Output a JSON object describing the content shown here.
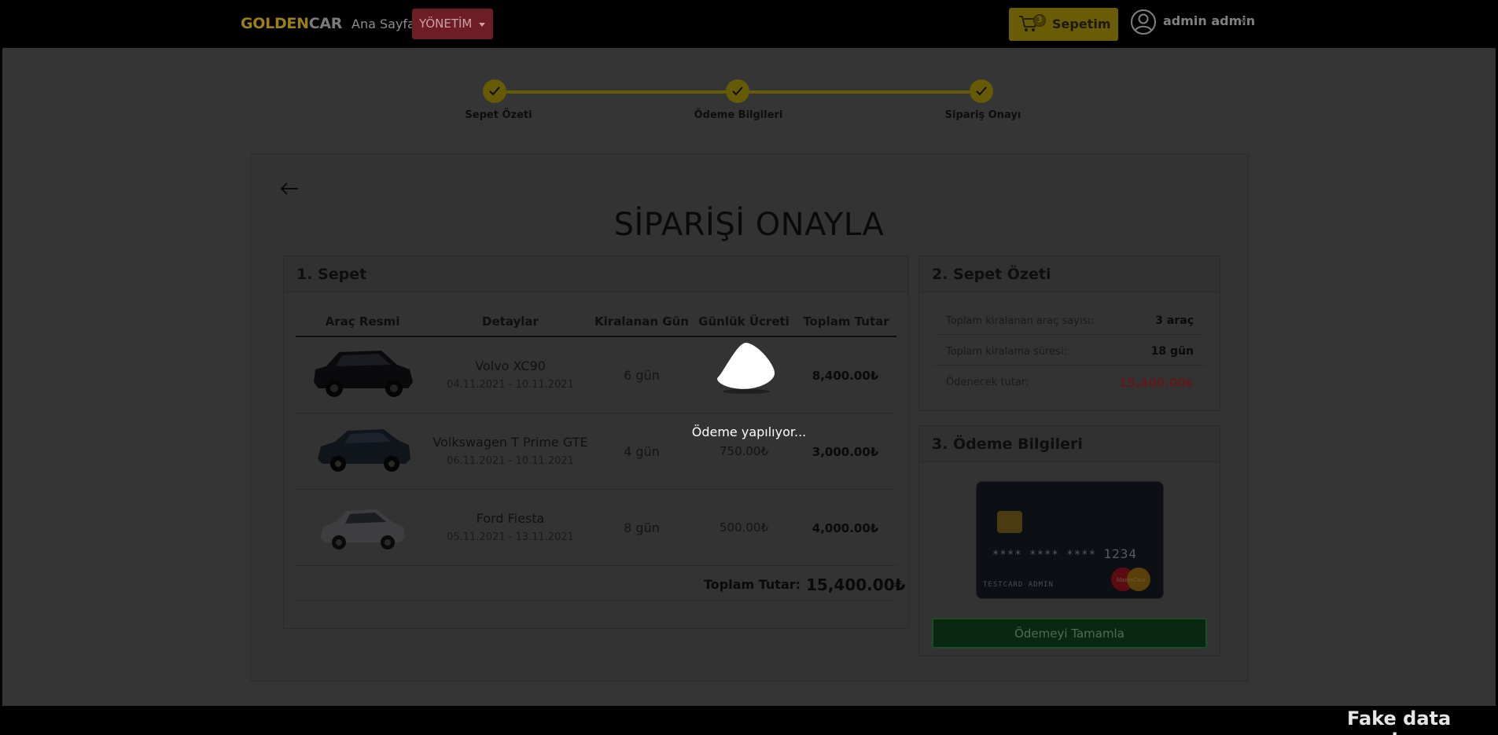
{
  "navbar": {
    "brand_gold": "GOLDEN",
    "brand_rest": "CAR",
    "home_link": "Ana Sayfa",
    "admin_menu": "YÖNETİM",
    "cart": {
      "label": "Sepetim",
      "count": "3"
    },
    "user": {
      "name": "admin admin"
    }
  },
  "stepper": {
    "steps": [
      "Sepet Özeti",
      "Ödeme Bilgileri",
      "Sipariş Onayı"
    ],
    "state": "all-complete"
  },
  "page": {
    "title": "SİPARİŞİ ONAYLA"
  },
  "cart_panel": {
    "title": "1. Sepet",
    "columns": [
      "Araç Resmi",
      "Detaylar",
      "Kiralanan Gün",
      "Günlük Ücreti",
      "Toplam Tutar"
    ],
    "rows": [
      {
        "car": "Volvo XC90",
        "dates": "04.11.2021 - 10.11.2021",
        "days": "6 gün",
        "daily": "",
        "total": "8,400.00₺"
      },
      {
        "car": "Volkswagen T Prime GTE",
        "dates": "06.11.2021 - 10.11.2021",
        "days": "4 gün",
        "daily": "750.00₺",
        "total": "3,000.00₺"
      },
      {
        "car": "Ford Fiesta",
        "dates": "05.11.2021 - 13.11.2021",
        "days": "8 gün",
        "daily": "500.00₺",
        "total": "4,000.00₺"
      }
    ],
    "grand_total_label": "Toplam Tutar:",
    "grand_total_value": "15,400.00₺"
  },
  "summary_panel": {
    "title": "2. Sepet Özeti",
    "rows": [
      {
        "label": "Toplam kiralanan araç sayısı:",
        "value": "3 araç"
      },
      {
        "label": "Toplam kiralama süresi:",
        "value": "18 gün"
      },
      {
        "label": "Ödenecek tutar:",
        "value": "15,400.00₺"
      }
    ]
  },
  "payment_panel": {
    "title": "3. Ödeme Bilgileri",
    "card": {
      "masked": "**** **** ****",
      "last4": "1234",
      "holder": "TESTCARD ADMIN",
      "brand": "MasterCard"
    },
    "submit_label": "Ödemeyi Tamamla"
  },
  "overlay": {
    "loading_text": "Ödeme yapılıyor..."
  },
  "watermark": "Fake data used",
  "colors": {
    "gold": "#ffd700",
    "accent_red": "#dc3545",
    "success": "#198754"
  }
}
